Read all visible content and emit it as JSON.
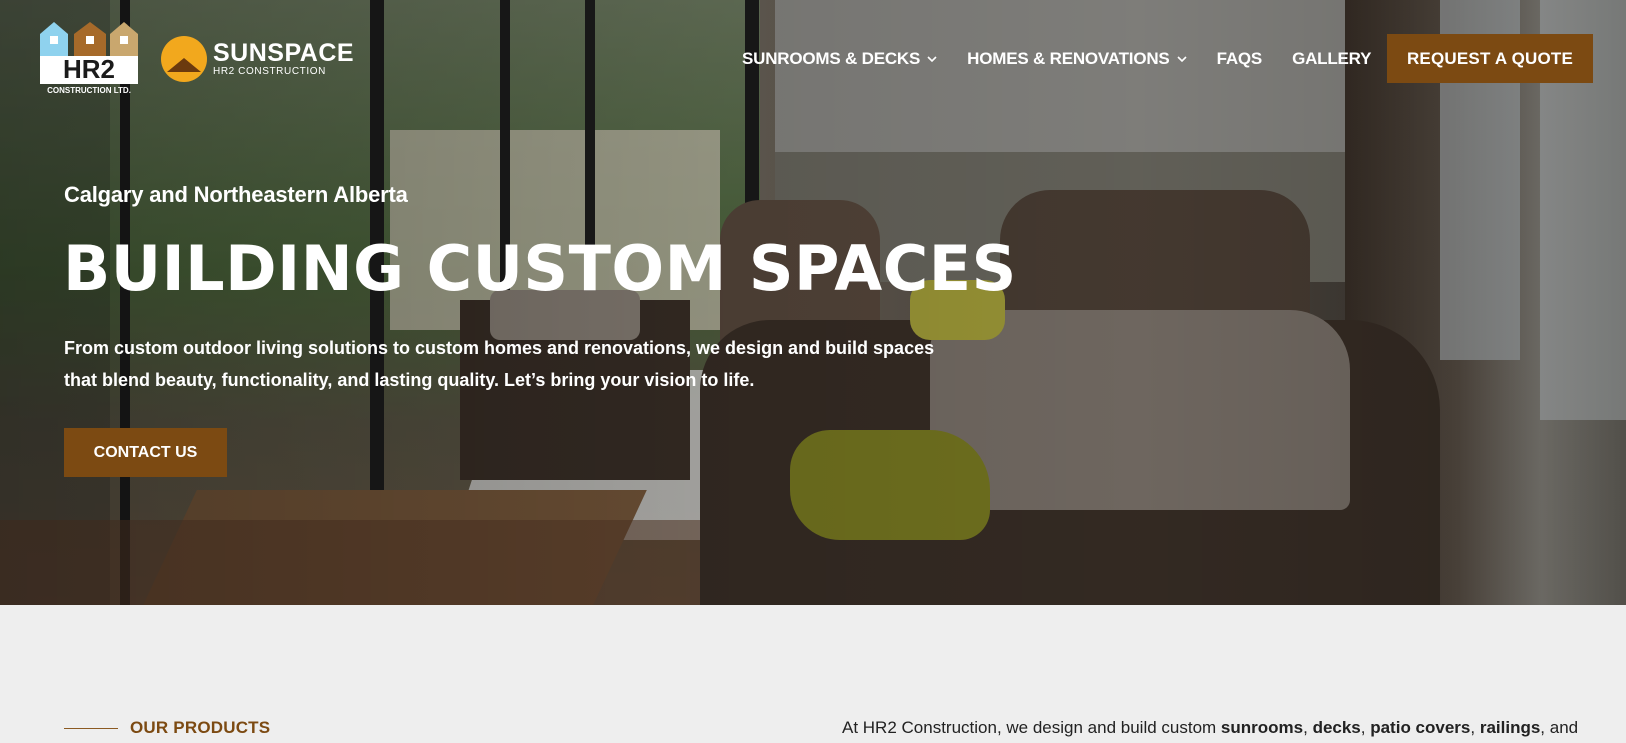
{
  "header": {
    "logo_hr2_alt": "HR2 Construction Ltd.",
    "logo_hr2_top": "HR2",
    "logo_hr2_bottom": "CONSTRUCTION LTD.",
    "logo_sunspace_brand": "SUNSPACE",
    "logo_sunspace_sub": "HR2 CONSTRUCTION",
    "nav": [
      {
        "label": "SUNROOMS & DECKS",
        "dropdown": true
      },
      {
        "label": "HOMES & RENOVATIONS",
        "dropdown": true
      },
      {
        "label": "FAQS",
        "dropdown": false
      },
      {
        "label": "GALLERY",
        "dropdown": false
      }
    ],
    "quote_button": "REQUEST A QUOTE"
  },
  "hero": {
    "region": "Calgary and Northeastern Alberta",
    "headline": "BUILDING CUSTOM SPACES",
    "lede": "From custom outdoor living solutions to custom homes and renovations, we design and build spaces that blend beauty, functionality, and lasting quality. Let’s bring your vision to life.",
    "contact_button": "CONTACT US"
  },
  "products": {
    "label": "OUR PRODUCTS",
    "intro_prefix": "At HR2 Construction, we design and build custom ",
    "intro_items": [
      "sunrooms",
      "decks",
      "patio covers",
      "railings"
    ],
    "intro_suffix": ", and"
  },
  "colors": {
    "accent": "#7c4a12",
    "sun": "#f2a81d",
    "logo_light_blue": "#8fd2ee",
    "logo_brown": "#a66a2a",
    "logo_tan": "#c9a76e",
    "page_bg": "#eeeeee"
  }
}
